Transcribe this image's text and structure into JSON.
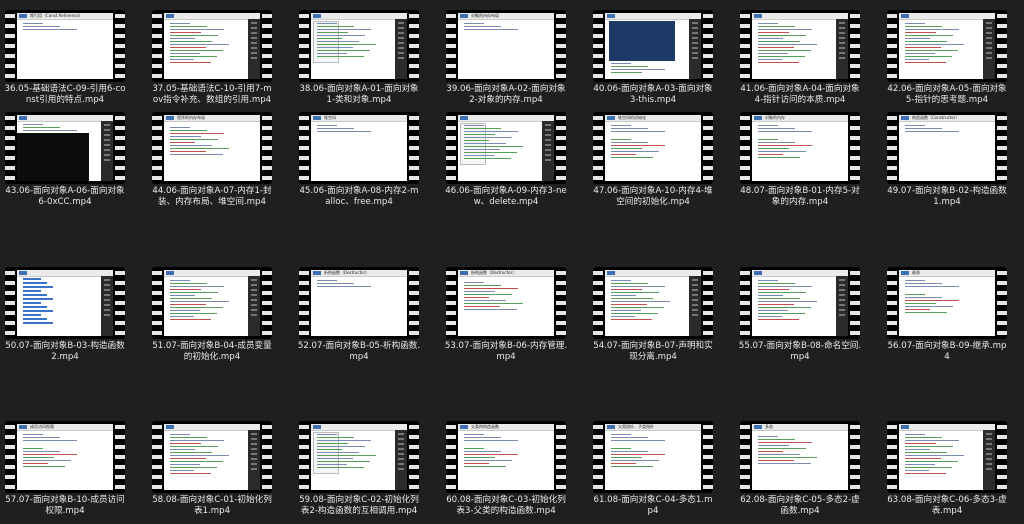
{
  "files": [
    {
      "label": "36.05-基础语法C-09-引用6-const引用的特点.mp4",
      "slide": "常引用（Const Reference）",
      "style": "text"
    },
    {
      "label": "37.05-基础语法C-10-引用7-mov指令补充、数组的引用.mp4",
      "slide": "",
      "style": "code"
    },
    {
      "label": "38.06-面向对象A-01-面向对象1-类和对象.mp4",
      "slide": "",
      "style": "ide"
    },
    {
      "label": "39.06-面向对象A-02-面向对象2-对象的内存.mp4",
      "slide": "对象的内存布局",
      "style": "text"
    },
    {
      "label": "40.06-面向对象A-03-面向对象3-this.mp4",
      "slide": "",
      "style": "bluebox"
    },
    {
      "label": "41.06-面向对象A-04-面向对象4-指针访问的本质.mp4",
      "slide": "",
      "style": "code"
    },
    {
      "label": "42.06-面向对象A-05-面向对象5-指针的思考题.mp4",
      "slide": "",
      "style": "code"
    },
    {
      "label": "43.06-面向对象A-06-面向对象6-0xCC.mp4",
      "slide": "",
      "style": "console"
    },
    {
      "label": "44.06-面向对象A-07-内存1-封装、内存布局、堆空间.mp4",
      "slide": "程序的内存布局",
      "style": "logo"
    },
    {
      "label": "45.06-面向对象A-08-内存2-malloc、free.mp4",
      "slide": "堆空间",
      "style": "text"
    },
    {
      "label": "46.06-面向对象A-09-内存3-new、delete.mp4",
      "slide": "",
      "style": "ide"
    },
    {
      "label": "47.06-面向对象A-10-内存4-堆空间的初始化.mp4",
      "slide": "堆空间的初始化",
      "style": "textcode"
    },
    {
      "label": "48.07-面向对象B-01-内存5-对象的内存.mp4",
      "slide": "对象的内存",
      "style": "textcode"
    },
    {
      "label": "49.07-面向对象B-02-构造函数1.mp4",
      "slide": "构造函数（Constructor）",
      "style": "text"
    },
    {
      "label": "50.07-面向对象B-03-构造函数2.mp4",
      "slide": "",
      "style": "list"
    },
    {
      "label": "51.07-面向对象B-04-成员变量的初始化.mp4",
      "slide": "",
      "style": "code"
    },
    {
      "label": "52.07-面向对象B-05-析构函数.mp4",
      "slide": "析构函数（Destructor）",
      "style": "text"
    },
    {
      "label": "53.07-面向对象B-06-内存管理.mp4",
      "slide": "析构函数（Destructor）",
      "style": "logo"
    },
    {
      "label": "54.07-面向对象B-07-声明和实现分离.mp4",
      "slide": "",
      "style": "code"
    },
    {
      "label": "55.07-面向对象B-08-命名空间.mp4",
      "slide": "",
      "style": "code"
    },
    {
      "label": "56.07-面向对象B-09-继承.mp4",
      "slide": "继承",
      "style": "textcode"
    },
    {
      "label": "57.07-面向对象B-10-成员访问权限.mp4",
      "slide": "成员访问权限",
      "style": "textcode"
    },
    {
      "label": "58.08-面向对象C-01-初始化列表1.mp4",
      "slide": "",
      "style": "code"
    },
    {
      "label": "59.08-面向对象C-02-初始化列表2-构造函数的互相调用.mp4",
      "slide": "",
      "style": "ide"
    },
    {
      "label": "60.08-面向对象C-03-初始化列表3-父类的构造函数.mp4",
      "slide": "父类的构造函数",
      "style": "textcode"
    },
    {
      "label": "61.08-面向对象C-04-多态1.mp4",
      "slide": "父类指针、子类指针",
      "style": "textcode"
    },
    {
      "label": "62.08-面向对象C-05-多态2-虚函数.mp4",
      "slide": "多态",
      "style": "logo"
    },
    {
      "label": "63.08-面向对象C-06-多态3-虚表.mp4",
      "slide": "",
      "style": "code"
    }
  ]
}
